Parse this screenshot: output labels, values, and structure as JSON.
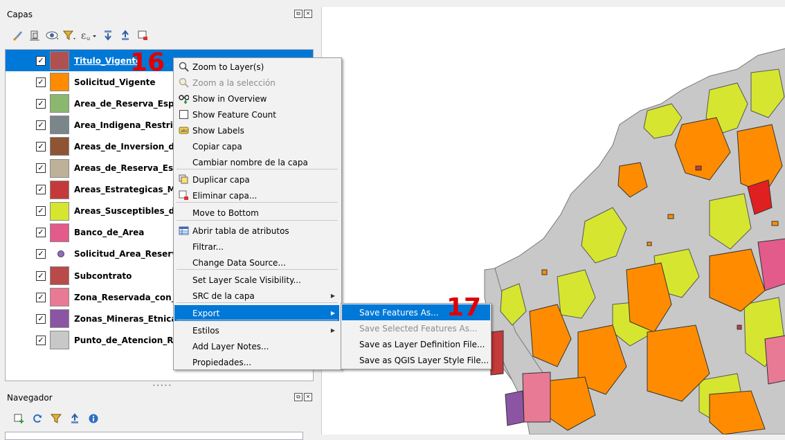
{
  "layers_panel": {
    "title": "Capas",
    "dock_float": "⧉",
    "dock_close": "✕",
    "toolbar_icons": [
      "style-paint-icon",
      "add-group-icon",
      "eye-icon",
      "filter-icon",
      "expression-filter-icon",
      "expand-all-icon",
      "collapse-all-icon",
      "remove-layer-icon"
    ],
    "layers": [
      {
        "name": "Titulo_Vigente",
        "checked": true,
        "color": "#b05050",
        "selected": true
      },
      {
        "name": "Solicitud_Vigente",
        "checked": true,
        "color": "#ff8c00"
      },
      {
        "name": "Area_de_Reserva_Especial_",
        "checked": true,
        "color": "#8ab86e"
      },
      {
        "name": "Area_Indigena_Restringida",
        "checked": true,
        "color": "#7a868a"
      },
      {
        "name": "Areas_de_Inversion_del_Es",
        "checked": true,
        "color": "#8e5434"
      },
      {
        "name": "Areas_de_Reserva_Especia",
        "checked": true,
        "color": "#bdb198"
      },
      {
        "name": "Areas_Estrategicas_Minera",
        "checked": true,
        "color": "#c43a3a"
      },
      {
        "name": "Areas_Susceptibles_de_la_",
        "checked": true,
        "color": "#d6e630"
      },
      {
        "name": "Banco_de_Area",
        "checked": true,
        "color": "#e35b8b"
      },
      {
        "name": "Solicitud_Area_Reserva_Es",
        "checked": true,
        "color": "#8e6fb0",
        "point": true
      },
      {
        "name": "Subcontrato",
        "checked": true,
        "color": "#b84a4a"
      },
      {
        "name": "Zona_Reservada_con_Pote",
        "checked": true,
        "color": "#e87a96"
      },
      {
        "name": "Zonas_Mineras_Etnicas",
        "checked": true,
        "color": "#8c55a4"
      },
      {
        "name": "Punto_de_Atencion_Regio",
        "checked": true,
        "color": "#c8c8c8"
      }
    ],
    "check_mark": "✓"
  },
  "navigator_panel": {
    "title": "Navegador",
    "toolbar_icons": [
      "add-selected-layers-icon",
      "refresh-icon",
      "filter-browser-icon",
      "collapse-all-icon",
      "info-icon"
    ]
  },
  "context_menu": {
    "items": [
      {
        "label": "Zoom to Layer(s)",
        "icon": "zoom-layer-icon"
      },
      {
        "label": "Zoom a la selección",
        "icon": "zoom-selection-icon",
        "disabled": true
      },
      {
        "label": "Show in Overview",
        "icon": "overview-glasses-icon"
      },
      {
        "label": "Show Feature Count",
        "checkbox": true
      },
      {
        "label": "Show Labels",
        "icon": "labels-icon"
      },
      {
        "label": "Copiar capa"
      },
      {
        "label": "Cambiar nombre de la capa"
      },
      {
        "label": "Duplicar capa",
        "icon": "duplicate-layer-icon"
      },
      {
        "label": "Eliminar capa...",
        "icon": "remove-layer-icon"
      },
      {
        "label": "Move to Bottom"
      },
      {
        "label": "Abrir tabla de atributos",
        "icon": "attribute-table-icon"
      },
      {
        "label": "Filtrar..."
      },
      {
        "label": "Change Data Source..."
      },
      {
        "label": "Set Layer Scale Visibility..."
      },
      {
        "label": "SRC de la capa",
        "submenu": true
      },
      {
        "label": "Export",
        "submenu": true,
        "highlight": true
      },
      {
        "label": "Estilos",
        "submenu": true
      },
      {
        "label": "Add Layer Notes..."
      },
      {
        "label": "Propiedades..."
      }
    ]
  },
  "export_submenu": {
    "items": [
      {
        "label": "Save Features As...",
        "highlight": true
      },
      {
        "label": "Save Selected Features As...",
        "disabled": true
      },
      {
        "label": "Save as Layer Definition File..."
      },
      {
        "label": "Save as QGIS Layer Style File..."
      }
    ]
  },
  "annotations": {
    "step16": "16",
    "step17": "17"
  },
  "colors": {
    "selection": "#0078d7",
    "annotation": "#e00000",
    "map_gray": "#c8c8c8",
    "map_orange": "#ff8c00",
    "map_yellow": "#d6e630"
  }
}
